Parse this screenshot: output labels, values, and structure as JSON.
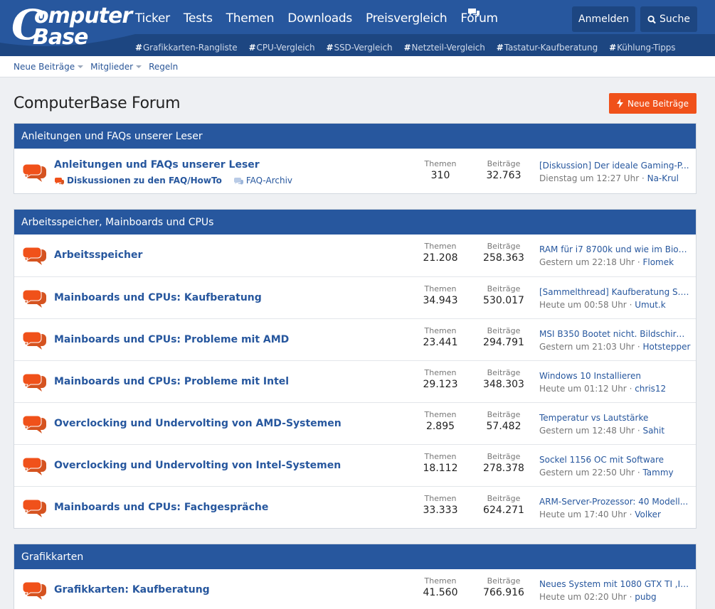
{
  "header": {
    "logo_line1": "omputer",
    "logo_line2": "Base",
    "logo_c": "C",
    "nav": [
      "Ticker",
      "Tests",
      "Themen",
      "Downloads",
      "Preisvergleich",
      "Forum"
    ],
    "login_label": "Anmelden",
    "search_label": "Suche",
    "tags": [
      "Grafikkarten-Rangliste",
      "CPU-Vergleich",
      "SSD-Vergleich",
      "Netzteil-Vergleich",
      "Tastatur-Kaufberatung",
      "Kühlung-Tipps"
    ],
    "hash": "#"
  },
  "subbar": {
    "items": [
      "Neue Beiträge",
      "Mitglieder",
      "Regeln"
    ]
  },
  "page": {
    "title": "ComputerBase Forum",
    "new_posts_button": "Neue Beiträge"
  },
  "labels": {
    "themen": "Themen",
    "beitraege": "Beiträge",
    "separator": " · "
  },
  "colors": {
    "brand_blue": "#27579e",
    "accent_orange": "#f0511a"
  },
  "blocks": [
    {
      "heading": "Anleitungen und FAQs unserer Leser",
      "nodes": [
        {
          "title": "Anleitungen und FAQs unserer Leser",
          "subforums": [
            "Diskussionen zu den FAQ/HowTo",
            "FAQ-Archiv"
          ],
          "themen": "310",
          "beitraege": "32.763",
          "latest_title": "[Diskussion] Der ideale Gaming-P...",
          "latest_time": "Dienstag um 12:27 Uhr",
          "latest_user": "Na-Krul"
        }
      ]
    },
    {
      "heading": "Arbeitsspeicher, Mainboards und CPUs",
      "nodes": [
        {
          "title": "Arbeitsspeicher",
          "themen": "21.208",
          "beitraege": "258.363",
          "latest_title": "RAM für i7 8700k und wie im Bios ...",
          "latest_time": "Gestern um 22:18 Uhr",
          "latest_user": "Flomek"
        },
        {
          "title": "Mainboards und CPUs: Kaufberatung",
          "themen": "34.943",
          "beitraege": "530.017",
          "latest_title": "[Sammelthread] Kaufberatung S. 1...",
          "latest_time": "Heute um 00:58 Uhr",
          "latest_user": "Umut.k"
        },
        {
          "title": "Mainboards und CPUs: Probleme mit AMD",
          "themen": "23.441",
          "beitraege": "294.791",
          "latest_title": "MSI B350 Bootet nicht. Bildschirm ...",
          "latest_time": "Gestern um 21:03 Uhr",
          "latest_user": "Hotstepper"
        },
        {
          "title": "Mainboards und CPUs: Probleme mit Intel",
          "themen": "29.123",
          "beitraege": "348.303",
          "latest_title": "Windows 10 Installieren",
          "latest_time": "Heute um 01:12 Uhr",
          "latest_user": "chris12"
        },
        {
          "title": "Overclocking und Undervolting von AMD-Systemen",
          "themen": "2.895",
          "beitraege": "57.482",
          "latest_title": "Temperatur vs Lautstärke",
          "latest_time": "Gestern um 12:48 Uhr",
          "latest_user": "Sahit"
        },
        {
          "title": "Overclocking und Undervolting von Intel-Systemen",
          "themen": "18.112",
          "beitraege": "278.378",
          "latest_title": "Sockel 1156 OC mit Software",
          "latest_time": "Gestern um 22:50 Uhr",
          "latest_user": "Tammy"
        },
        {
          "title": "Mainboards und CPUs: Fachgespräche",
          "themen": "33.333",
          "beitraege": "624.271",
          "latest_title": "ARM-Server-Prozessor: 40 Modell...",
          "latest_time": "Heute um 17:40 Uhr",
          "latest_user": "Volker"
        }
      ]
    },
    {
      "heading": "Grafikkarten",
      "nodes": [
        {
          "title": "Grafikkarten: Kaufberatung",
          "themen": "41.560",
          "beitraege": "766.916",
          "latest_title": "Neues System mit 1080 GTX TI ,In...",
          "latest_time": "Heute um 02:20 Uhr",
          "latest_user": "pubg"
        }
      ]
    }
  ]
}
